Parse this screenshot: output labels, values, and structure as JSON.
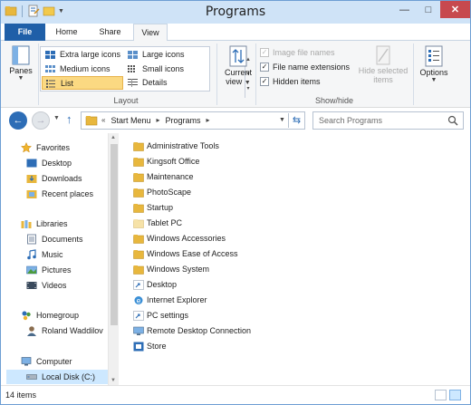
{
  "window": {
    "title": "Programs"
  },
  "ribbon": {
    "tabs": {
      "file": "File",
      "home": "Home",
      "share": "Share",
      "view": "View"
    },
    "panes": {
      "label": "Panes"
    },
    "layout": {
      "group_label": "Layout",
      "options": {
        "extra_large_icons": "Extra large icons",
        "large_icons": "Large icons",
        "medium_icons": "Medium icons",
        "small_icons": "Small icons",
        "list": "List",
        "details": "Details"
      },
      "selected": "List"
    },
    "current_view": {
      "line1": "Current",
      "line2": "view"
    },
    "show_hide": {
      "group_label": "Show/hide",
      "image_file_names": {
        "label": "Image file names",
        "checked": false,
        "enabled": false
      },
      "file_name_extensions": {
        "label": "File name extensions",
        "checked": true
      },
      "hidden_items": {
        "label": "Hidden items",
        "checked": true
      },
      "hide_selected": {
        "line1": "Hide selected",
        "line2": "items"
      }
    },
    "options": {
      "label": "Options"
    }
  },
  "address": {
    "crumbs": [
      "Start Menu",
      "Programs"
    ],
    "search_placeholder": "Search Programs"
  },
  "nav": {
    "favorites": "Favorites",
    "desktop": "Desktop",
    "downloads": "Downloads",
    "recent_places": "Recent places",
    "libraries": "Libraries",
    "documents": "Documents",
    "music": "Music",
    "pictures": "Pictures",
    "videos": "Videos",
    "homegroup": "Homegroup",
    "user": "Roland Waddilov",
    "computer": "Computer",
    "local_disk": "Local Disk (C:)"
  },
  "files": [
    {
      "name": "Administrative Tools",
      "type": "folder"
    },
    {
      "name": "Kingsoft Office",
      "type": "folder"
    },
    {
      "name": "Maintenance",
      "type": "folder"
    },
    {
      "name": "PhotoScape",
      "type": "folder"
    },
    {
      "name": "Startup",
      "type": "folder"
    },
    {
      "name": "Tablet PC",
      "type": "folder-light"
    },
    {
      "name": "Windows Accessories",
      "type": "folder"
    },
    {
      "name": "Windows Ease of Access",
      "type": "folder"
    },
    {
      "name": "Windows System",
      "type": "folder"
    },
    {
      "name": "Desktop",
      "type": "shortcut"
    },
    {
      "name": "Internet Explorer",
      "type": "shortcut"
    },
    {
      "name": "PC settings",
      "type": "shortcut"
    },
    {
      "name": "Remote Desktop Connection",
      "type": "shortcut"
    },
    {
      "name": "Store",
      "type": "shortcut"
    }
  ],
  "status": {
    "count": "14 items"
  },
  "colors": {
    "accent": "#1f5fa8",
    "titlebar": "#cfe3f7",
    "folder": "#e8b73d",
    "selection": "#cde8ff"
  }
}
